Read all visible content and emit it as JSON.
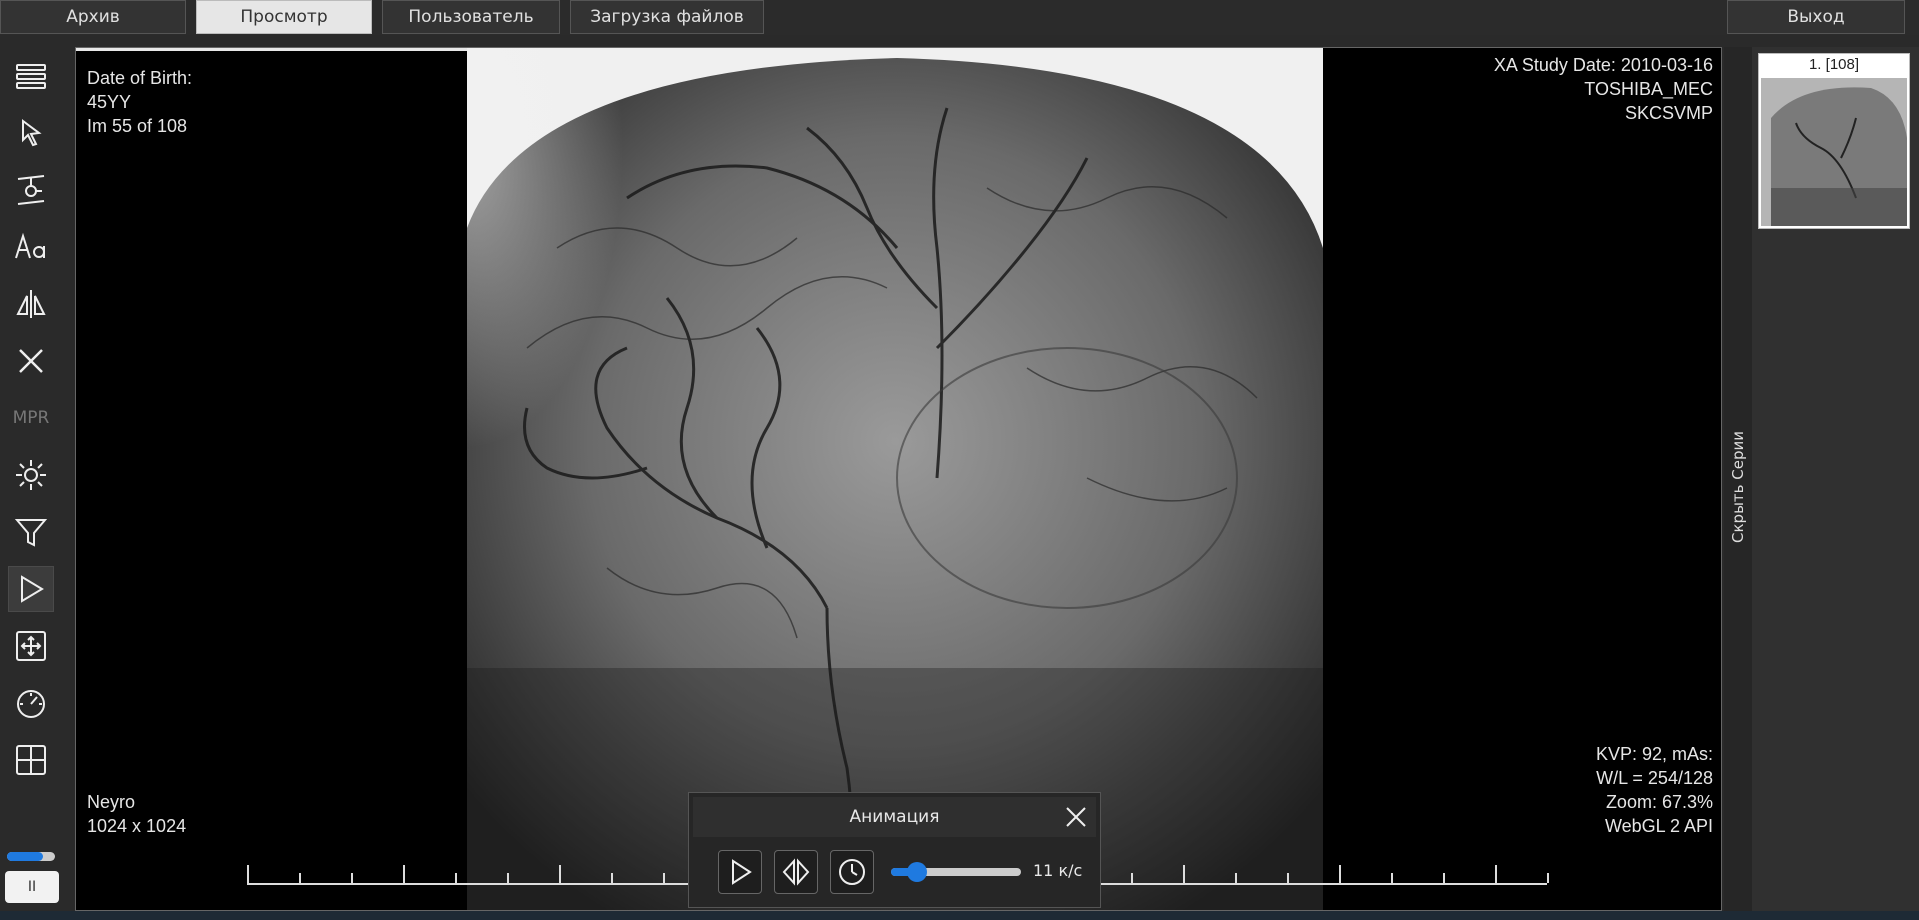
{
  "topbar": {
    "archive": "Архив",
    "view": "Просмотр",
    "user": "Пользователь",
    "upload": "Загрузка файлов",
    "exit": "Выход"
  },
  "toolbar": {
    "icons": [
      "menu-icon",
      "pointer-icon",
      "probe-icon",
      "text-annotation-icon",
      "flip-icon",
      "delete-icon",
      "mpr",
      "brightness-icon",
      "filter-icon",
      "play-icon",
      "fit-screen-icon",
      "speed-icon",
      "layout-grid-icon"
    ],
    "mpr_label": "MPR",
    "pause_label": "II",
    "accent": "#1f7ae0"
  },
  "overlay": {
    "dob": "Date of Birth:",
    "age": "45YY",
    "image_index": "Im 55 of 108",
    "study_date": "XA Study Date: 2010-03-16",
    "manufacturer": "TOSHIBA_MEC",
    "station": "SKCSVMP",
    "kvp": "KVP: 92, mAs:",
    "wl": "W/L = 254/128",
    "zoom": "Zoom: 67.3%",
    "renderer": "WebGL 2 API",
    "series_name": "Neyro",
    "resolution": "1024 x 1024"
  },
  "animation": {
    "title": "Анимация",
    "speed": "11 к/с",
    "speed_fraction": 0.2
  },
  "series": {
    "toggle_label": "Скрыть Серии",
    "thumb_label": "1. [108]"
  },
  "progress": {
    "current": 55,
    "total": 108
  }
}
